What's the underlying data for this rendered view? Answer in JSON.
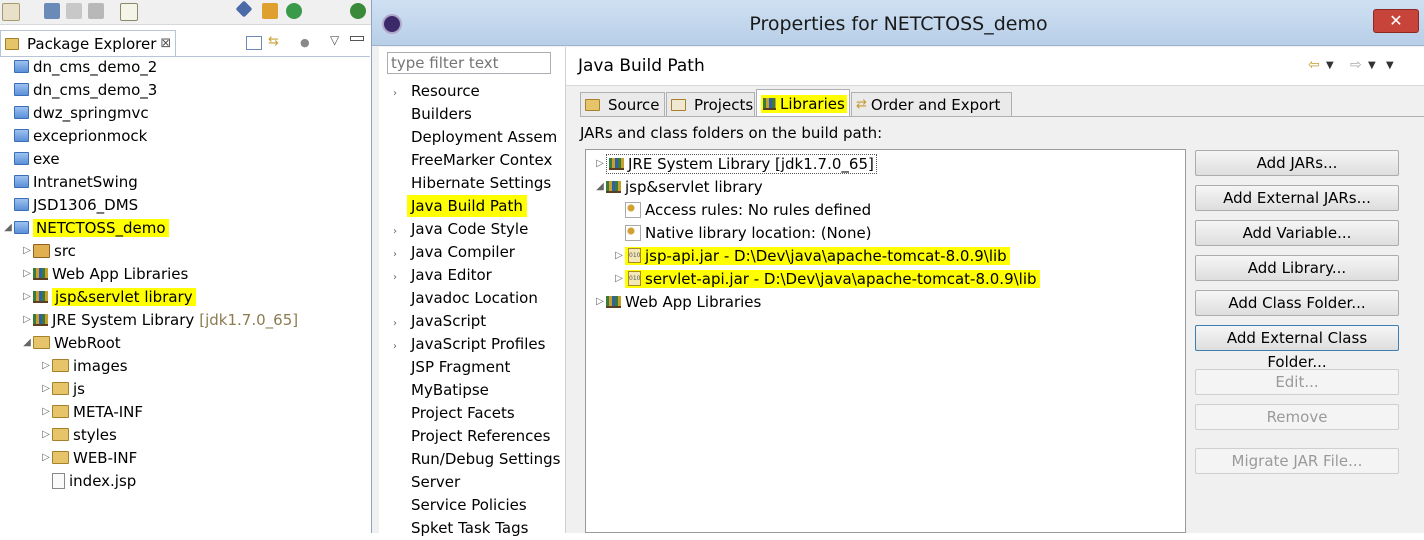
{
  "package_explorer": {
    "tab_title": "Package Explorer",
    "tab_close": "⊠",
    "items": [
      {
        "label": "dn_cms_demo_2",
        "type": "project",
        "indent": 0
      },
      {
        "label": "dn_cms_demo_3",
        "type": "project",
        "indent": 0
      },
      {
        "label": "dwz_springmvc",
        "type": "project",
        "indent": 0
      },
      {
        "label": "exceprionmock",
        "type": "project",
        "indent": 0
      },
      {
        "label": "exe",
        "type": "project",
        "indent": 0
      },
      {
        "label": "IntranetSwing",
        "type": "project",
        "indent": 0
      },
      {
        "label": "JSD1306_DMS",
        "type": "project",
        "indent": 0
      },
      {
        "label": "NETCTOSS_demo",
        "type": "project",
        "indent": 0,
        "expanded": true,
        "highlighted": true
      },
      {
        "label": "src",
        "type": "src",
        "indent": 1
      },
      {
        "label": "Web App Libraries",
        "type": "library",
        "indent": 1
      },
      {
        "label": "jsp&servlet library",
        "type": "library",
        "indent": 1,
        "highlighted": true
      },
      {
        "label": "JRE System Library",
        "suffix": "[jdk1.7.0_65]",
        "type": "library",
        "indent": 1
      },
      {
        "label": "WebRoot",
        "type": "folder",
        "indent": 1,
        "expanded": true
      },
      {
        "label": "images",
        "type": "folder",
        "indent": 2
      },
      {
        "label": "js",
        "type": "folder",
        "indent": 2
      },
      {
        "label": "META-INF",
        "type": "folder",
        "indent": 2
      },
      {
        "label": "styles",
        "type": "folder",
        "indent": 2
      },
      {
        "label": "WEB-INF",
        "type": "folder",
        "indent": 2
      },
      {
        "label": "index.jsp",
        "type": "file",
        "indent": 2,
        "leaf": true
      }
    ]
  },
  "dialog": {
    "title": "Properties for NETCTOSS_demo",
    "close_label": "✕",
    "filter_placeholder": "type filter text",
    "nav_items": [
      {
        "label": "Resource",
        "expandable": true
      },
      {
        "label": "Builders"
      },
      {
        "label": "Deployment Assem"
      },
      {
        "label": "FreeMarker Contex"
      },
      {
        "label": "Hibernate Settings"
      },
      {
        "label": "Java Build Path",
        "selected": true
      },
      {
        "label": "Java Code Style",
        "expandable": true
      },
      {
        "label": "Java Compiler",
        "expandable": true
      },
      {
        "label": "Java Editor",
        "expandable": true
      },
      {
        "label": "Javadoc Location"
      },
      {
        "label": "JavaScript",
        "expandable": true
      },
      {
        "label": "JavaScript Profiles",
        "expandable": true
      },
      {
        "label": "JSP Fragment"
      },
      {
        "label": "MyBatipse"
      },
      {
        "label": "Project Facets"
      },
      {
        "label": "Project References"
      },
      {
        "label": "Run/Debug Settings"
      },
      {
        "label": "Server"
      },
      {
        "label": "Service Policies"
      },
      {
        "label": "Spket Task Tags"
      }
    ],
    "page_title": "Java Build Path",
    "tabs": [
      {
        "label": "Source"
      },
      {
        "label": "Projects"
      },
      {
        "label": "Libraries",
        "active": true
      },
      {
        "label": "Order and Export"
      }
    ],
    "jars_label": "JARs and class folders on the build path:",
    "library_tree": [
      {
        "label": "JRE System Library [jdk1.7.0_65]",
        "type": "library",
        "indent": 0,
        "boxed": true
      },
      {
        "label": "jsp&servlet library",
        "type": "library",
        "indent": 0,
        "expanded": true
      },
      {
        "label": "Access rules: No rules defined",
        "type": "rules",
        "indent": 1
      },
      {
        "label": "Native library location: (None)",
        "type": "rules",
        "indent": 1
      },
      {
        "label": "jsp-api.jar - D:\\Dev\\java\\apache-tomcat-8.0.9\\lib",
        "type": "jar",
        "indent": 1,
        "highlighted": true,
        "expandable": true
      },
      {
        "label": "servlet-api.jar - D:\\Dev\\java\\apache-tomcat-8.0.9\\lib",
        "type": "jar",
        "indent": 1,
        "highlighted": true,
        "expandable": true
      },
      {
        "label": "Web App Libraries",
        "type": "library",
        "indent": 0
      }
    ],
    "buttons": [
      {
        "label": "Add JARs...",
        "enabled": true
      },
      {
        "label": "Add External JARs...",
        "enabled": true
      },
      {
        "label": "Add Variable...",
        "enabled": true
      },
      {
        "label": "Add Library...",
        "enabled": true
      },
      {
        "label": "Add Class Folder...",
        "enabled": true
      },
      {
        "label": "Add External Class Folder...",
        "enabled": true,
        "focused": true
      },
      {
        "label": "Edit...",
        "enabled": false
      },
      {
        "label": "Remove",
        "enabled": false
      },
      {
        "label": "Migrate JAR File...",
        "enabled": false
      }
    ]
  }
}
